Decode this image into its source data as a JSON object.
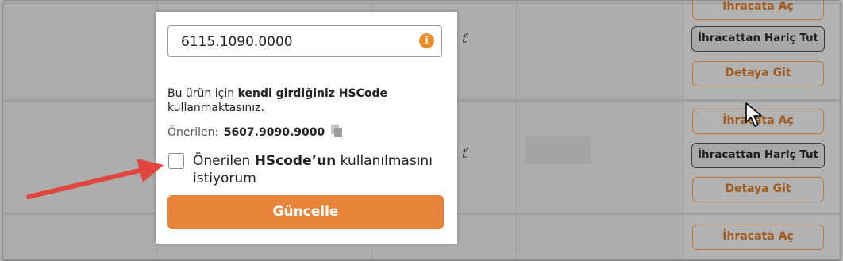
{
  "table": {
    "rows": [
      {
        "actions": {
          "export_open": "İhracata Aç",
          "export_exclude": "İhracattan Hariç Tut",
          "details": "Detaya Git"
        }
      },
      {
        "actions": {
          "export_open": "İhracata Aç",
          "export_exclude": "İhracattan Hariç Tut",
          "details": "Detaya Git"
        }
      },
      {
        "actions": {
          "export_open": "İhracata Aç"
        }
      }
    ]
  },
  "popup": {
    "hscode_value": "6115.1090.0000",
    "info_icon": "info-icon",
    "desc_part1": "Bu ürün için ",
    "desc_bold": "kendi girdiğiniz HSCode",
    "desc_part2": "kullanmaktasınız.",
    "suggested_label": "Önerilen:",
    "suggested_code": "5607.9090.9000",
    "checkbox_part1": "Önerilen ",
    "checkbox_bold": "HScode’un",
    "checkbox_part2": " kullanılmasını istiyorum",
    "checkbox_checked": false,
    "update_button": "Güncelle"
  },
  "colors": {
    "accent": "#e8843a",
    "overlay": "#adadad",
    "annotation_arrow": "#e0453e"
  }
}
